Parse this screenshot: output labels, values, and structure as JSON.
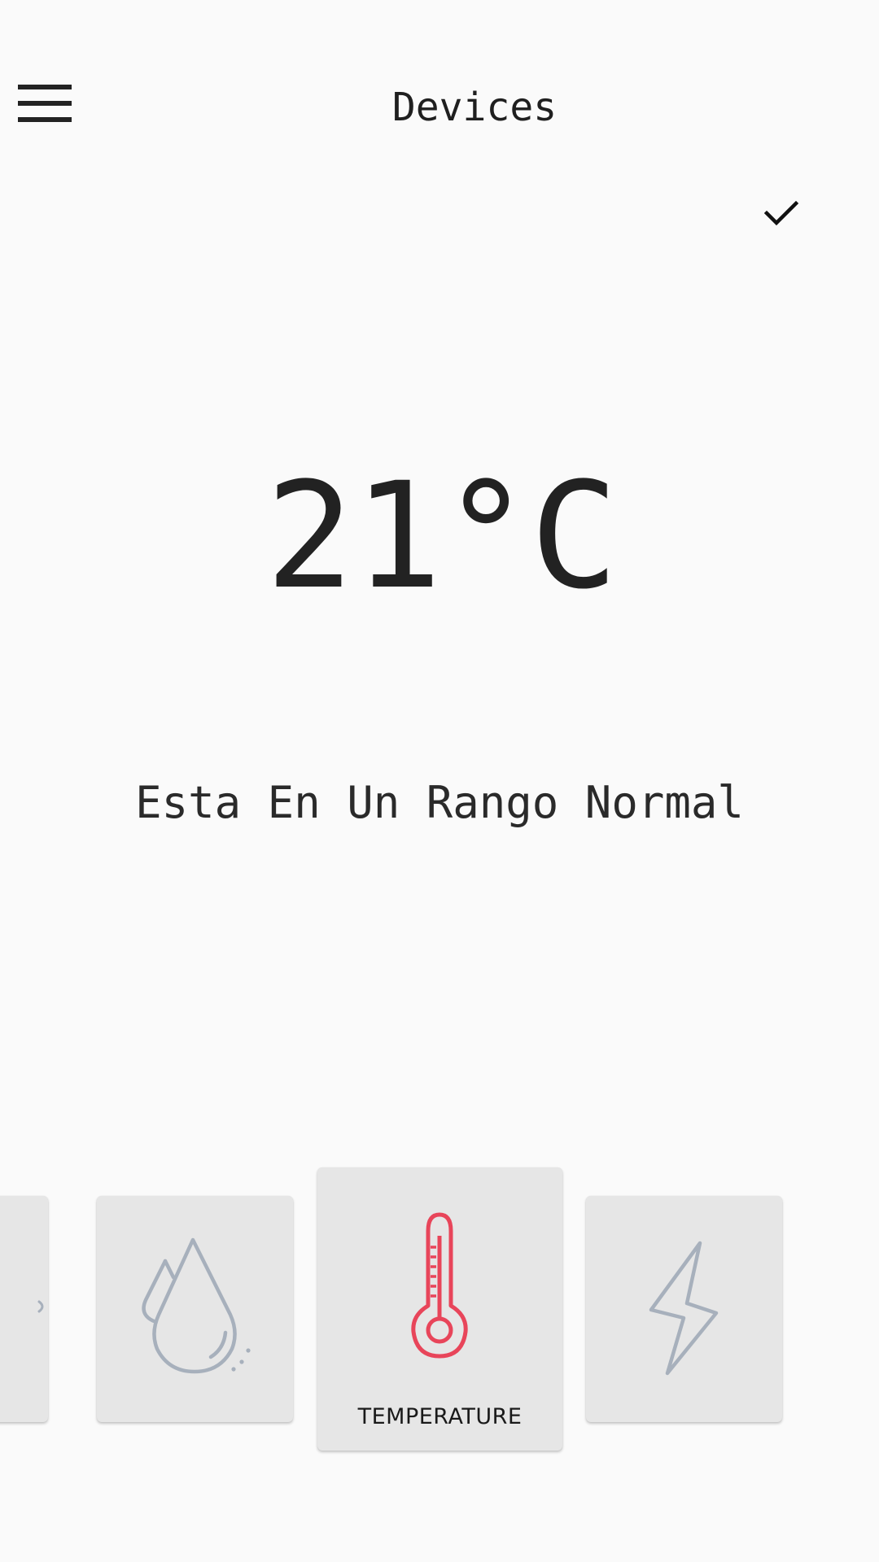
{
  "header": {
    "title": "Devices",
    "menu_icon": "hamburger-menu-icon",
    "confirm_icon": "check-icon"
  },
  "main": {
    "reading": "21°C",
    "status": "Esta En Un Rango Normal"
  },
  "cards": [
    {
      "id": "partial",
      "icon": "unknown-icon",
      "label": ""
    },
    {
      "id": "humidity",
      "icon": "water-drop-icon",
      "label": ""
    },
    {
      "id": "temperature",
      "icon": "thermometer-icon",
      "label": "TEMPERATURE",
      "selected": true
    },
    {
      "id": "energy",
      "icon": "lightning-bolt-icon",
      "label": ""
    }
  ],
  "colors": {
    "background": "#fafafa",
    "card_background": "#e6e6e6",
    "active_icon": "#e8455a",
    "inactive_icon": "#a7b0bc",
    "text": "#222222"
  }
}
